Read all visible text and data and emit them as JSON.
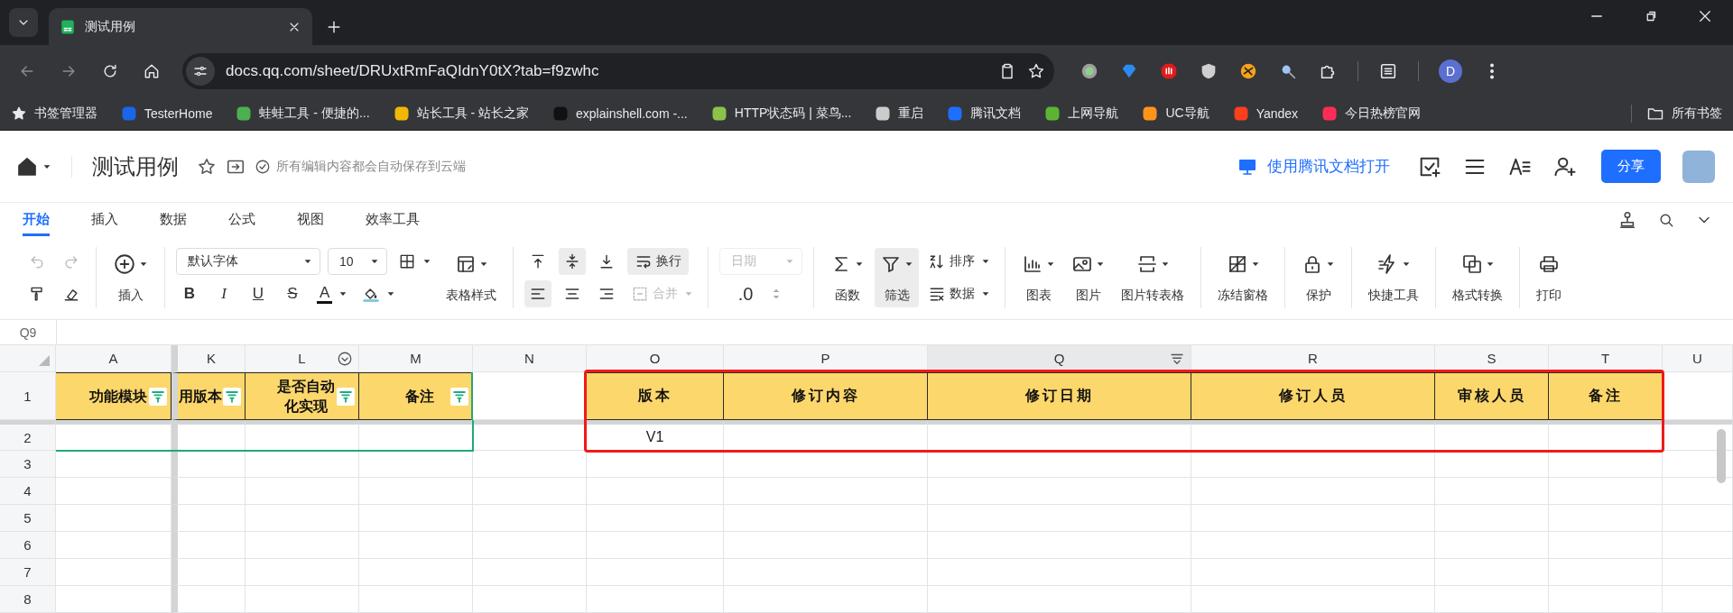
{
  "browser": {
    "tabs": [
      {
        "title": "测试用例",
        "selected": true
      }
    ],
    "nav": {
      "back_disabled": true,
      "forward_disabled": true
    },
    "url": "docs.qq.com/sheet/DRUxtRmFaQIdnY0tX?tab=f9zwhc",
    "profile": "D",
    "bookmarks": [
      {
        "label": "书签管理器",
        "kind": "star"
      },
      {
        "label": "TesterHome",
        "kind": "favicon",
        "color": "#1a66e8"
      },
      {
        "label": "蛙蛙工具 - 便捷的...",
        "kind": "favicon",
        "color": "#4caf50"
      },
      {
        "label": "站长工具 - 站长之家",
        "kind": "favicon",
        "color": "#f2b705"
      },
      {
        "label": "explainshell.com -...",
        "kind": "favicon",
        "color": "#111111"
      },
      {
        "label": "HTTP状态码 | 菜鸟...",
        "kind": "favicon",
        "color": "#8bc34a"
      },
      {
        "label": "重启",
        "kind": "favicon",
        "color": "#cccccc"
      },
      {
        "label": "腾讯文档",
        "kind": "favicon",
        "color": "#1e6fff"
      },
      {
        "label": "上网导航",
        "kind": "favicon",
        "color": "#5cb531"
      },
      {
        "label": "UC导航",
        "kind": "favicon",
        "color": "#ff9419"
      },
      {
        "label": "Yandex",
        "kind": "favicon",
        "color": "#fc3f1d"
      },
      {
        "label": "今日热榜官网",
        "kind": "favicon",
        "color": "#ff2d55"
      }
    ],
    "all_bookmarks": "所有书签"
  },
  "app": {
    "title": "测试用例",
    "save_status": "所有编辑内容都会自动保存到云端",
    "open_in_app": "使用腾讯文档打开",
    "share": "分享"
  },
  "ribbon_tabs": [
    {
      "label": "开始",
      "selected": true
    },
    {
      "label": "插入",
      "selected": false
    },
    {
      "label": "数据",
      "selected": false
    },
    {
      "label": "公式",
      "selected": false
    },
    {
      "label": "视图",
      "selected": false
    },
    {
      "label": "效率工具",
      "selected": false
    }
  ],
  "toolbar": {
    "undo": {
      "disabled": true
    },
    "redo": {
      "disabled": true
    },
    "insert": "插入",
    "font": "默认字体",
    "font_size": "10",
    "table_style": "表格样式",
    "format_buttons": [
      {
        "label": "B",
        "kind": "bold"
      },
      {
        "label": "I",
        "kind": "italic"
      },
      {
        "label": "U",
        "kind": "underline"
      },
      {
        "label": "S",
        "kind": "strike"
      }
    ],
    "text_color": "A",
    "vertical_align": [
      {
        "selected": false
      },
      {
        "selected": true
      },
      {
        "selected": false
      }
    ],
    "horizontal_align": [
      {
        "selected": true
      },
      {
        "selected": false
      },
      {
        "selected": false
      }
    ],
    "wrap": {
      "label": "换行",
      "selected": true
    },
    "merge": {
      "label": "合并",
      "disabled": true
    },
    "number_format": {
      "value": "日期",
      "disabled": true
    },
    "decimal": ".0",
    "tool_groups": [
      [
        {
          "kind": "sigma",
          "label": "函数",
          "dropdown": true,
          "active": false
        },
        {
          "kind": "filter",
          "label": "筛选",
          "dropdown": true,
          "active": true
        },
        {
          "kind": "pair",
          "items": [
            {
              "kind": "sort",
              "label": "排序"
            },
            {
              "kind": "data",
              "label": "数据"
            }
          ]
        }
      ],
      [
        {
          "kind": "chart",
          "label": "图表",
          "dropdown": true,
          "active": false
        },
        {
          "kind": "image",
          "label": "图片",
          "dropdown": true,
          "active": false
        },
        {
          "kind": "scan",
          "label": "图片转表格",
          "dropdown": true,
          "active": false
        }
      ],
      [
        {
          "kind": "freeze",
          "label": "冻结窗格",
          "dropdown": true,
          "active": false
        }
      ],
      [
        {
          "kind": "lock",
          "label": "保护",
          "dropdown": true,
          "active": false
        }
      ],
      [
        {
          "kind": "bolt",
          "label": "快捷工具",
          "dropdown": true,
          "active": false
        }
      ],
      [
        {
          "kind": "copy",
          "label": "格式转换",
          "dropdown": true,
          "active": false
        }
      ],
      [
        {
          "kind": "print",
          "label": "打印",
          "dropdown": false,
          "active": false
        }
      ]
    ]
  },
  "sheet": {
    "name_box": "Q9",
    "columns": [
      {
        "label": "A",
        "selected": false,
        "menu": false
      },
      {
        "label": "K",
        "selected": false,
        "menu": false
      },
      {
        "label": "L",
        "selected": false,
        "menu": true
      },
      {
        "label": "M",
        "selected": false,
        "menu": false
      },
      {
        "label": "N",
        "selected": false,
        "menu": false
      },
      {
        "label": "O",
        "selected": false,
        "menu": false
      },
      {
        "label": "P",
        "selected": false,
        "menu": false
      },
      {
        "label": "Q",
        "selected": true,
        "menu": false
      },
      {
        "label": "R",
        "selected": false,
        "menu": false
      },
      {
        "label": "S",
        "selected": false,
        "menu": false
      },
      {
        "label": "T",
        "selected": false,
        "menu": false
      },
      {
        "label": "U",
        "selected": false,
        "menu": false
      }
    ],
    "rows": [
      {
        "number": "1",
        "cells": [
          {
            "text": "功能模块",
            "filled": true,
            "filter": true
          },
          {
            "text": "用版本",
            "filled": true,
            "filter": true
          },
          {
            "text": "是否自动化实现",
            "filled": true,
            "filter": true
          },
          {
            "text": "备注",
            "filled": true,
            "filter": true
          },
          {
            "filled": false,
            "filter": false
          },
          {
            "text": "版本",
            "filled": true,
            "filter": false
          },
          {
            "text": "修订内容",
            "filled": true,
            "filter": false
          },
          {
            "text": "修订日期",
            "filled": true,
            "filter": false
          },
          {
            "text": "修订人员",
            "filled": true,
            "filter": false
          },
          {
            "text": "审核人员",
            "filled": true,
            "filter": false
          },
          {
            "text": "备注",
            "filled": true,
            "filter": false
          },
          {
            "filled": false,
            "filter": false
          }
        ]
      },
      {
        "number": "2",
        "cells": [
          {
            "filled": false
          },
          {
            "filled": false
          },
          {
            "filled": false
          },
          {
            "filled": false
          },
          {
            "filled": false
          },
          {
            "text": "V1",
            "filled": false
          },
          {
            "filled": false
          },
          {
            "filled": false
          },
          {
            "filled": false
          },
          {
            "filled": false
          },
          {
            "filled": false
          },
          {
            "filled": false
          }
        ]
      },
      {
        "number": "3"
      },
      {
        "number": "4"
      },
      {
        "number": "5"
      },
      {
        "number": "6"
      },
      {
        "number": "7"
      },
      {
        "number": "8"
      }
    ]
  }
}
